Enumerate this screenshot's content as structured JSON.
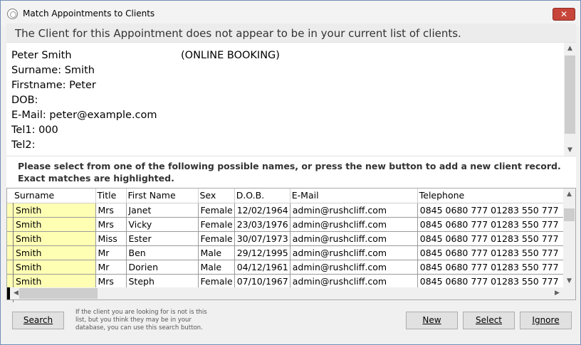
{
  "window": {
    "title": "Match Appointments to Clients",
    "close_label": "✕"
  },
  "banner": "The Client for this Appointment does not appear to be in your current list of clients.",
  "client": {
    "name_line": "Peter Smith",
    "tag": "(ONLINE BOOKING)",
    "surname_line": "Surname: Smith",
    "firstname_line": "Firstname: Peter",
    "dob_line": "DOB:",
    "email_line": "E-Mail: peter@example.com",
    "tel1_line": "Tel1: 000",
    "tel2_line": "Tel2:"
  },
  "instructions": "Please select from one of the following possible names, or press the new button to add a new client record. Exact matches are highlighted.",
  "table": {
    "columns": [
      "Surname",
      "Title",
      "First Name",
      "Sex",
      "D.O.B.",
      "E-Mail",
      "Telephone"
    ],
    "rows": [
      [
        "Smith",
        "Mrs",
        "Janet",
        "Female",
        "12/02/1964",
        "admin@rushcliff.com",
        "0845 0680 777 01283 550 777"
      ],
      [
        "Smith",
        "Mrs",
        "Vicky",
        "Female",
        "23/03/1976",
        "admin@rushcliff.com",
        "0845 0680 777 01283 550 777"
      ],
      [
        "Smith",
        "Miss",
        "Ester",
        "Female",
        "30/07/1973",
        "admin@rushcliff.com",
        "0845 0680 777 01283 550 777"
      ],
      [
        "Smith",
        "Mr",
        "Ben",
        "Male",
        "29/12/1995",
        "admin@rushcliff.com",
        "0845 0680 777 01283 550 777"
      ],
      [
        "Smith",
        "Mr",
        "Dorien",
        "Male",
        "04/12/1961",
        "admin@rushcliff.com",
        "0845 0680 777 01283 550 777"
      ],
      [
        "Smith",
        "Mrs",
        "Steph",
        "Female",
        "07/10/1967",
        "admin@rushcliff.com",
        "0845 0680 777 01283 550 777"
      ]
    ]
  },
  "footer": {
    "search_label": "Search",
    "hint": "If the client you are looking for is not is this list, but you think they may be in your database, you can use this search button.",
    "new_label": "New",
    "select_label": "Select",
    "ignore_label": "Ignore"
  },
  "colors": {
    "highlight": "#ffffb4",
    "close_button": "#c7453a"
  }
}
